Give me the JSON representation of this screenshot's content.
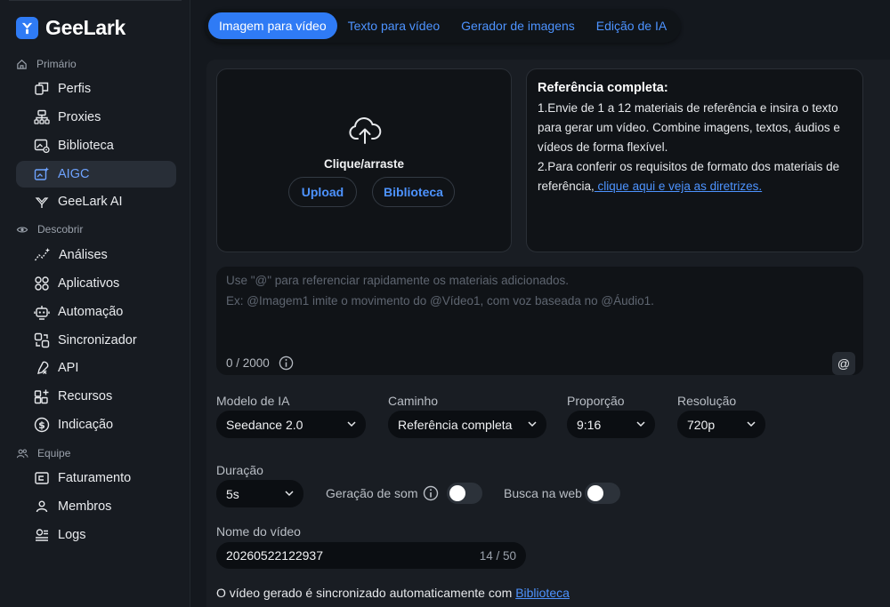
{
  "app": {
    "brand": "GeeLark",
    "accent": "#2f7bf5"
  },
  "sidebar": {
    "sections": [
      {
        "title": "Primário",
        "icon": "home-icon"
      },
      {
        "title": "Descobrir",
        "icon": "eye-icon"
      },
      {
        "title": "Equipe",
        "icon": "team-icon"
      }
    ],
    "items": [
      {
        "label": "Perfis",
        "icon": "profiles-icon"
      },
      {
        "label": "Proxies",
        "icon": "proxies-icon"
      },
      {
        "label": "Biblioteca",
        "icon": "library-icon"
      },
      {
        "label": "AIGC",
        "icon": "aigc-icon",
        "active": true
      },
      {
        "label": "GeeLark AI",
        "icon": "geelark-ai-icon"
      },
      {
        "label": "Análises",
        "icon": "analytics-icon"
      },
      {
        "label": "Aplicativos",
        "icon": "apps-icon"
      },
      {
        "label": "Automação",
        "icon": "automation-icon"
      },
      {
        "label": "Sincronizador",
        "icon": "sync-icon"
      },
      {
        "label": "API",
        "icon": "api-icon"
      },
      {
        "label": "Recursos",
        "icon": "resources-icon"
      },
      {
        "label": "Indicação",
        "icon": "referral-icon"
      },
      {
        "label": "Faturamento",
        "icon": "billing-icon"
      },
      {
        "label": "Membros",
        "icon": "members-icon"
      },
      {
        "label": "Logs",
        "icon": "logs-icon"
      }
    ]
  },
  "tabs": [
    {
      "label": "Imagem para vídeo",
      "active": true
    },
    {
      "label": "Texto para vídeo"
    },
    {
      "label": "Gerador de imagens"
    },
    {
      "label": "Edição de IA"
    }
  ],
  "upload": {
    "title": "Clique/arraste",
    "upload_label": "Upload",
    "library_label": "Biblioteca"
  },
  "info": {
    "title": "Referência completa:",
    "line1": "1.Envie de 1 a 12 materiais de referência e insira o texto para gerar um vídeo. Combine imagens, textos, áudios e vídeos de forma flexível.",
    "line2": "2.Para conferir os requisitos de formato dos materiais de referência,",
    "link": " clique aqui e veja as diretrizes."
  },
  "prompt": {
    "placeholder_line1": "Use \"@\" para referenciar rapidamente os materiais adicionados.",
    "placeholder_line2": "Ex: @Imagem1 imite o movimento do @Vídeo1, com voz baseada no @Áudio1.",
    "counter": "0 / 2000",
    "at_label": "@"
  },
  "options": {
    "model": {
      "label": "Modelo de IA",
      "value": "Seedance 2.0"
    },
    "path": {
      "label": "Caminho",
      "value": "Referência completa"
    },
    "ratio": {
      "label": "Proporção",
      "value": "9:16"
    },
    "resolution": {
      "label": "Resolução",
      "value": "720p"
    },
    "duration": {
      "label": "Duração",
      "value": "5s"
    },
    "sound": {
      "label": "Geração de som",
      "on": false
    },
    "web": {
      "label": "Busca na web",
      "on": false
    }
  },
  "video_name": {
    "label": "Nome do vídeo",
    "value": "20260522122937",
    "count": "14 / 50"
  },
  "footer": {
    "text": "O vídeo gerado é sincronizado automaticamente com ",
    "link": "Biblioteca"
  }
}
